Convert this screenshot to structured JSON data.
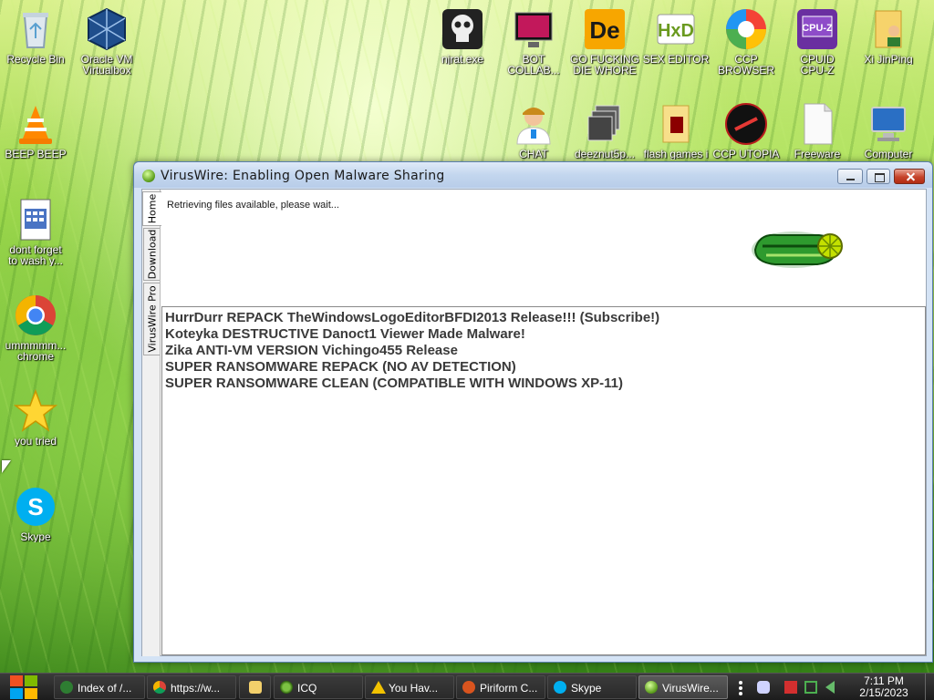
{
  "desktop": {
    "icons": [
      {
        "label": "Recycle Bin",
        "icon": "recycle-bin-icon"
      },
      {
        "label": "Oracle VM\nVirtualbox",
        "icon": "virtualbox-icon"
      },
      {
        "label": "BEEP BEEP",
        "icon": "vlc-icon"
      },
      {
        "label": "dont forget\nto wash y...",
        "icon": "document-icon"
      },
      {
        "label": "ummmmm...\nchrome",
        "icon": "chrome-icon"
      },
      {
        "label": "you tried",
        "icon": "star-icon"
      },
      {
        "label": "Skype",
        "icon": "skype-icon"
      },
      {
        "label": "njrat.exe",
        "icon": "skull-icon"
      },
      {
        "label": "BOT\nCOLLAB...",
        "icon": "monitor-icon"
      },
      {
        "label": "GO FUCKING\nDIE WHORE",
        "icon": "de-icon"
      },
      {
        "label": "SEX EDITOR",
        "icon": "hxd-icon"
      },
      {
        "label": "CCP\nBROWSER",
        "icon": "browser-icon"
      },
      {
        "label": "CPUID\nCPU-Z",
        "icon": "cpuz-icon"
      },
      {
        "label": "Xi JinPing",
        "icon": "user-folder-icon"
      },
      {
        "label": "CHAT",
        "icon": "doctor-icon"
      },
      {
        "label": "deeznut5p...",
        "icon": "stack-icon"
      },
      {
        "label": "flash games i",
        "icon": "folder-icon"
      },
      {
        "label": "CCP UTOPIA",
        "icon": "utopia-icon"
      },
      {
        "label": "Freeware",
        "icon": "page-icon"
      },
      {
        "label": "Computer",
        "icon": "computer-icon"
      }
    ]
  },
  "window": {
    "title": "VirusWire: Enabling Open Malware Sharing",
    "tabs": [
      "Home",
      "Download",
      "VirusWire Pro"
    ],
    "status": "Retrieving files available, please wait...",
    "items": [
      "HurrDurr REPACK TheWindowsLogoEditorBFDI2013 Release!!! (Subscribe!)",
      "Koteyka DESTRUCTIVE Danoct1 Viewer Made Malware!",
      "Zika ANTI-VM VERSION Vichingo455 Release",
      "SUPER RANSOMWARE REPACK (NO AV DETECTION)",
      "SUPER RANSOMWARE CLEAN (COMPATIBLE WITH WINDOWS XP-11)"
    ]
  },
  "taskbar": {
    "buttons": [
      {
        "label": "Index of /...",
        "color": "#2e7d32"
      },
      {
        "label": "https://w...",
        "color": "#e53935"
      },
      {
        "label": "",
        "color": "#f3d06b"
      },
      {
        "label": "ICQ",
        "color": "#7cc242"
      },
      {
        "label": "You Hav...",
        "color": "#f2c200"
      },
      {
        "label": "Piriform C...",
        "color": "#d9541e"
      },
      {
        "label": "Skype",
        "color": "#00aff0"
      },
      {
        "label": "VirusWire...",
        "color": "#6ab02a"
      }
    ],
    "clock": {
      "time": "7:11 PM",
      "date": "2/15/2023"
    }
  }
}
